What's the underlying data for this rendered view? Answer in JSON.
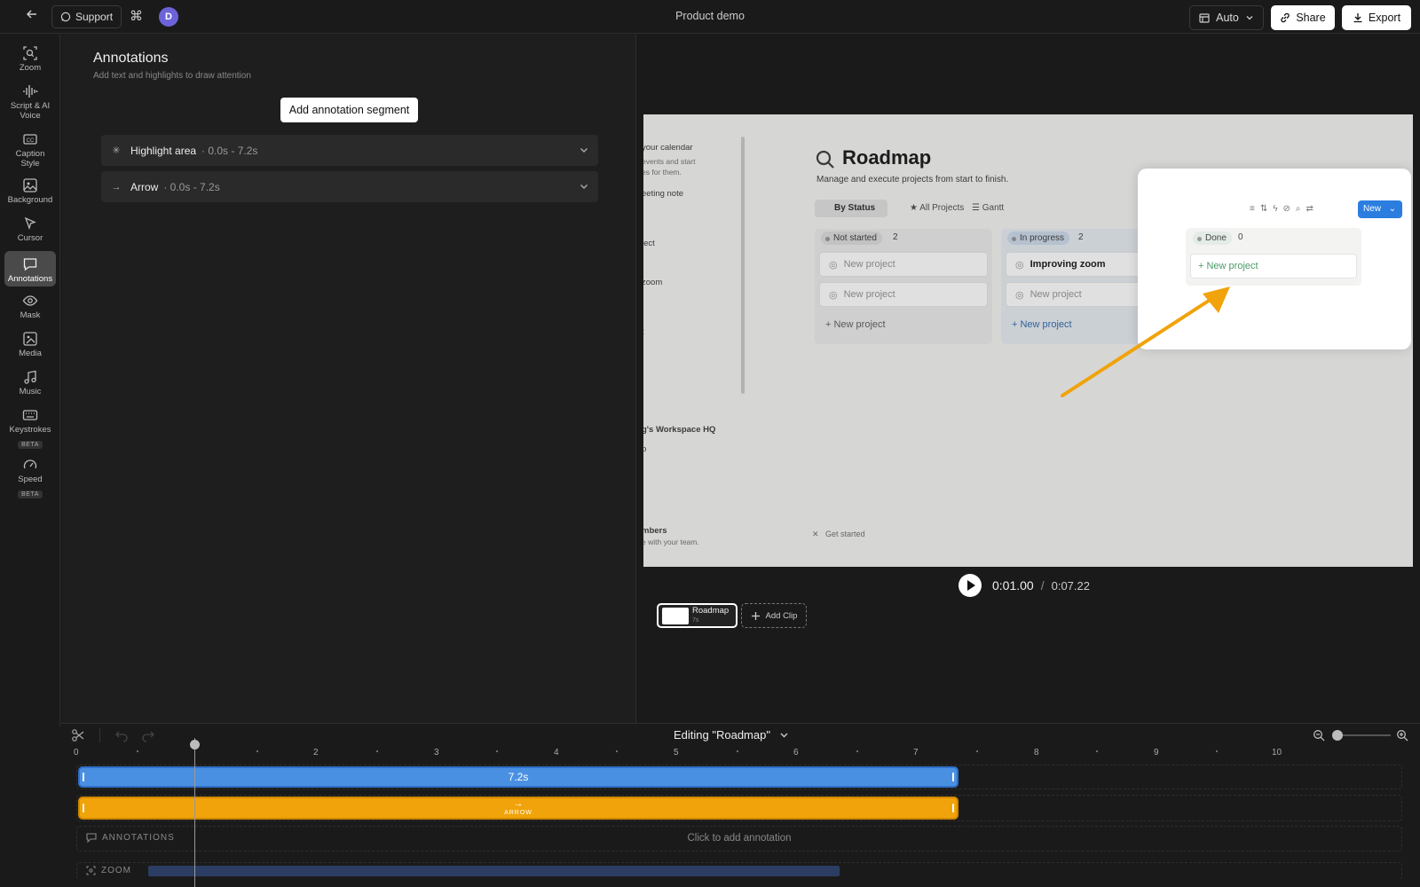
{
  "topbar": {
    "back_icon": "arrow-left-icon",
    "support_label": "Support",
    "cmd_icon": "command-icon",
    "avatar_initial": "D",
    "title": "Product demo",
    "layout_label": "Auto",
    "share_label": "Share",
    "export_label": "Export"
  },
  "sidebar": {
    "items": [
      {
        "label": "Zoom",
        "icon": "zoom-icon"
      },
      {
        "label": "Script & AI Voice",
        "icon": "waveform-icon"
      },
      {
        "label": "Caption Style",
        "icon": "cc-icon"
      },
      {
        "label": "Background",
        "icon": "image-icon"
      },
      {
        "label": "Cursor",
        "icon": "cursor-icon"
      },
      {
        "label": "Annotations",
        "icon": "comment-icon",
        "active": true
      },
      {
        "label": "Mask",
        "icon": "eye-icon"
      },
      {
        "label": "Media",
        "icon": "media-icon"
      },
      {
        "label": "Music",
        "icon": "music-icon"
      },
      {
        "label": "Keystrokes",
        "icon": "keyboard-icon",
        "badge": "BETA"
      },
      {
        "label": "Speed",
        "icon": "speed-icon",
        "badge": "BETA"
      }
    ]
  },
  "panel": {
    "title": "Annotations",
    "subtitle": "Add text and highlights to draw attention",
    "add_button": "Add annotation segment",
    "items": [
      {
        "name": "Highlight area",
        "time": "· 0.0s - 7.2s",
        "icon": "sparkle-icon"
      },
      {
        "name": "Arrow",
        "time": "· 0.0s - 7.2s",
        "icon": "arrow-right-icon"
      }
    ]
  },
  "preview": {
    "page_title": "Roadmap",
    "page_desc": "Manage and execute projects from start to finish.",
    "views": [
      "By Status",
      "All Projects",
      "Gantt"
    ],
    "sidebar_fragments": [
      "your calendar",
      "events and start",
      "es for them.",
      "eeting note",
      "ject",
      "zoom",
      "t",
      "g's Workspace HQ",
      "p",
      "mbers",
      "e with your team."
    ],
    "get_started": "Get started",
    "new_button": "New",
    "columns": [
      {
        "status": "Not started",
        "count": "2",
        "cards": [
          "New project",
          "New project"
        ],
        "add": "New project"
      },
      {
        "status": "In progress",
        "count": "2",
        "cards": [
          "Improving zoom",
          "New project"
        ],
        "add": "New project"
      },
      {
        "status": "Done",
        "count": "0",
        "cards": [],
        "add": "New project"
      }
    ],
    "arrow_color": "#f0a30a"
  },
  "player": {
    "current_time": "0:01.00",
    "separator": "/",
    "total_time": "0:07.22"
  },
  "clips": {
    "clip_name": "Roadmap",
    "clip_duration": "7s",
    "add_clip": "Add Clip"
  },
  "timeline": {
    "editing_label": "Editing \"Roadmap\"",
    "ruler_labels": [
      "0",
      "2",
      "3",
      "4",
      "5",
      "6",
      "7",
      "8",
      "9",
      "10"
    ],
    "zoom_bar_label": "7.2s",
    "arrow_bar_label": "ARROW",
    "annotations_label": "ANNOTATIONS",
    "annotations_hint": "Click to add annotation",
    "zoom_label": "ZOOM",
    "colors": {
      "zoom_bar": "#4a90e2",
      "arrow_bar": "#f0a30a"
    }
  }
}
